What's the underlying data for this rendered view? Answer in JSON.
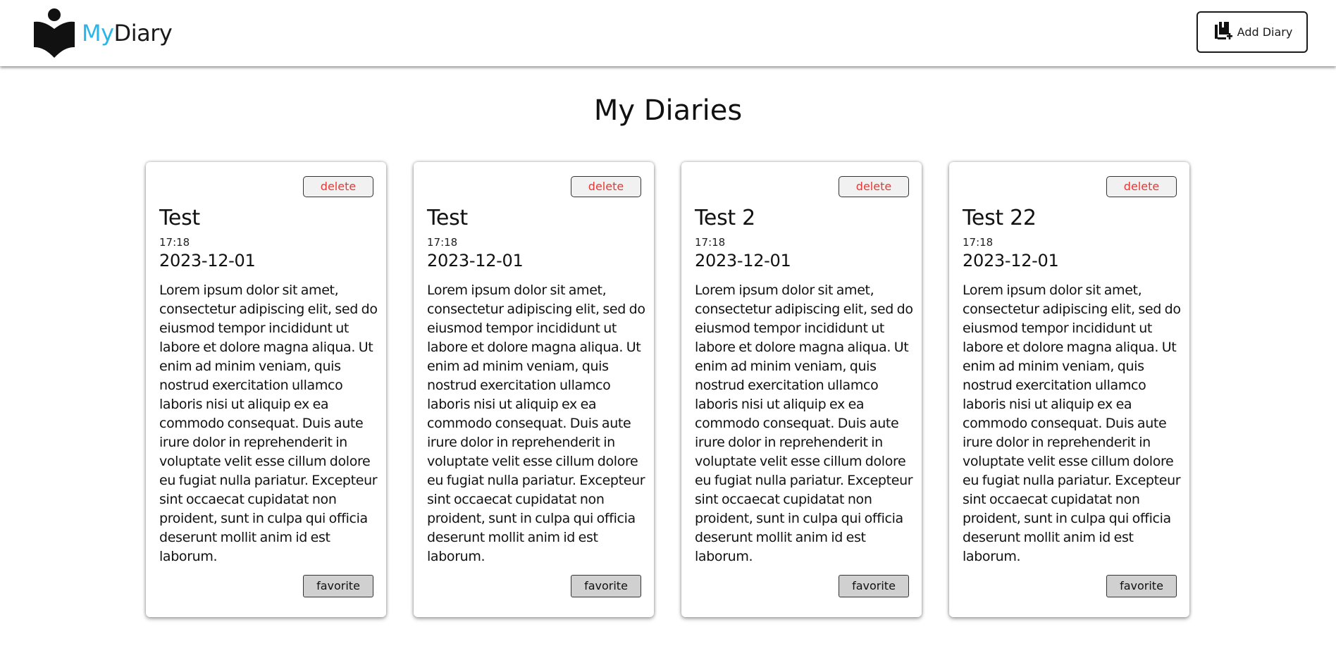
{
  "header": {
    "brand": {
      "my": "My",
      "diary": "Diary",
      "logo_icon": "reading-person-book-icon"
    },
    "add_button": {
      "label": "Add Diary",
      "icon": "add-book-icon"
    }
  },
  "main": {
    "title": "My Diaries"
  },
  "cards": [
    {
      "delete_label": "delete",
      "title": "Test",
      "time": "17:18",
      "date": "2023-12-01",
      "body": "Lorem ipsum dolor sit amet, consectetur adipiscing elit, sed do eiusmod tempor incididunt ut labore et dolore magna aliqua. Ut enim ad minim veniam, quis nostrud exercitation ullamco laboris nisi ut aliquip ex ea commodo consequat. Duis aute irure dolor in reprehenderit in voluptate velit esse cillum dolore eu fugiat nulla pariatur. Excepteur sint occaecat cupidatat non proident, sunt in culpa qui officia deserunt mollit anim id est laborum.",
      "favorite_label": "favorite"
    },
    {
      "delete_label": "delete",
      "title": "Test",
      "time": "17:18",
      "date": "2023-12-01",
      "body": "Lorem ipsum dolor sit amet, consectetur adipiscing elit, sed do eiusmod tempor incididunt ut labore et dolore magna aliqua. Ut enim ad minim veniam, quis nostrud exercitation ullamco laboris nisi ut aliquip ex ea commodo consequat. Duis aute irure dolor in reprehenderit in voluptate velit esse cillum dolore eu fugiat nulla pariatur. Excepteur sint occaecat cupidatat non proident, sunt in culpa qui officia deserunt mollit anim id est laborum.",
      "favorite_label": "favorite"
    },
    {
      "delete_label": "delete",
      "title": "Test 2",
      "time": "17:18",
      "date": "2023-12-01",
      "body": "Lorem ipsum dolor sit amet, consectetur adipiscing elit, sed do eiusmod tempor incididunt ut labore et dolore magna aliqua. Ut enim ad minim veniam, quis nostrud exercitation ullamco laboris nisi ut aliquip ex ea commodo consequat. Duis aute irure dolor in reprehenderit in voluptate velit esse cillum dolore eu fugiat nulla pariatur. Excepteur sint occaecat cupidatat non proident, sunt in culpa qui officia deserunt mollit anim id est laborum.",
      "favorite_label": "favorite"
    },
    {
      "delete_label": "delete",
      "title": "Test 22",
      "time": "17:18",
      "date": "2023-12-01",
      "body": "Lorem ipsum dolor sit amet, consectetur adipiscing elit, sed do eiusmod tempor incididunt ut labore et dolore magna aliqua. Ut enim ad minim veniam, quis nostrud exercitation ullamco laboris nisi ut aliquip ex ea commodo consequat. Duis aute irure dolor in reprehenderit in voluptate velit esse cillum dolore eu fugiat nulla pariatur. Excepteur sint occaecat cupidatat non proident, sunt in culpa qui officia deserunt mollit anim id est laborum.",
      "favorite_label": "favorite"
    }
  ],
  "colors": {
    "brand_accent": "#29b6e8",
    "delete_text": "#e53935",
    "favorite_bg": "#d0d0d0"
  }
}
